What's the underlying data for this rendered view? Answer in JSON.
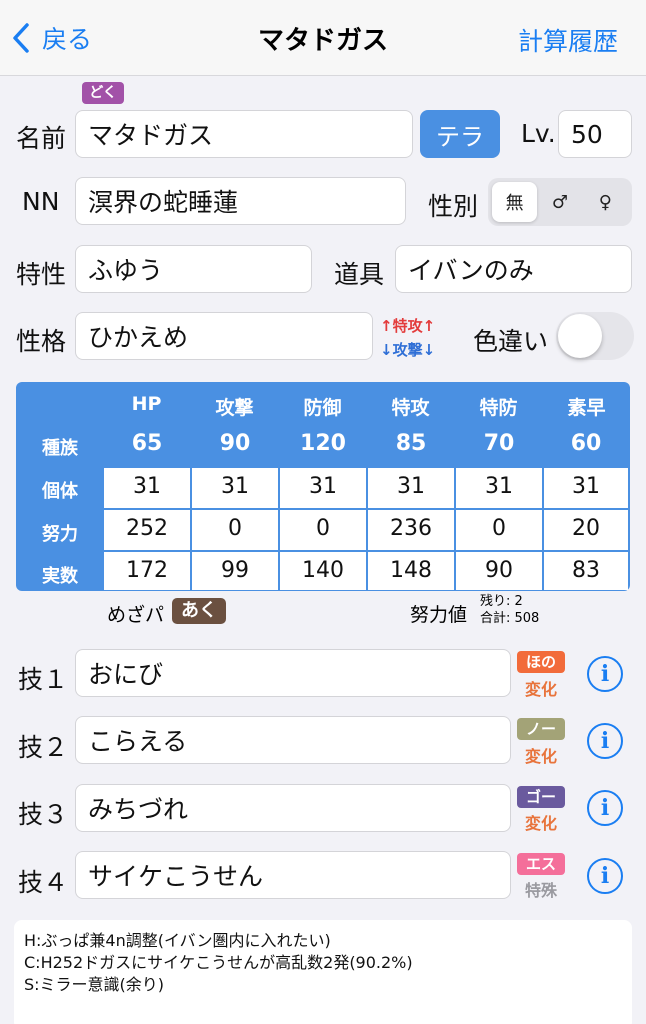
{
  "nav": {
    "back_label": "戻る",
    "title": "マタドガス",
    "history_label": "計算履歴"
  },
  "type_badge": {
    "label": "どく",
    "color": "#a252a8"
  },
  "form": {
    "name_label": "名前",
    "name_value": "マタドガス",
    "tera_label": "テラ",
    "level_label": "Lv.",
    "level_value": "50",
    "nn_label": "NN",
    "nn_value": "溟界の蛇睡蓮",
    "gender_label": "性別",
    "gender_options": [
      "無",
      "♂",
      "♀"
    ],
    "gender_selected": "無",
    "ability_label": "特性",
    "ability_value": "ふゆう",
    "item_label": "道具",
    "item_value": "イバンのみ",
    "nature_label": "性格",
    "nature_value": "ひかえめ",
    "nature_up": "↑特攻↑",
    "nature_down": "↓攻撃↓",
    "shiny_label": "色違い",
    "shiny_on": false
  },
  "stats": {
    "headers": [
      "HP",
      "攻撃",
      "防御",
      "特攻",
      "特防",
      "素早"
    ],
    "rows": [
      {
        "label": "種族",
        "values": [
          "65",
          "90",
          "120",
          "85",
          "70",
          "60"
        ]
      },
      {
        "label": "個体",
        "values": [
          "31",
          "31",
          "31",
          "31",
          "31",
          "31"
        ]
      },
      {
        "label": "努力",
        "values": [
          "252",
          "0",
          "0",
          "236",
          "0",
          "20"
        ]
      },
      {
        "label": "実数",
        "values": [
          "172",
          "99",
          "140",
          "148",
          "90",
          "83"
        ]
      }
    ]
  },
  "hidden_power": {
    "label": "めざパ",
    "type": "あく",
    "color": "#6b5040"
  },
  "ev_summary": {
    "label": "努力値",
    "remaining": "残り: 2",
    "total": "合計: 508"
  },
  "moves": [
    {
      "label": "技１",
      "name": "おにび",
      "type": "ほの",
      "type_color": "#f26b3a",
      "category": "変化",
      "category_color": "#e8743c"
    },
    {
      "label": "技２",
      "name": "こらえる",
      "type": "ノー",
      "type_color": "#a3a377",
      "category": "変化",
      "category_color": "#e8743c"
    },
    {
      "label": "技３",
      "name": "みちづれ",
      "type": "ゴー",
      "type_color": "#6a5a9e",
      "category": "変化",
      "category_color": "#e8743c"
    },
    {
      "label": "技４",
      "name": "サイケこうせん",
      "type": "エス",
      "type_color": "#f46f9a",
      "category": "特殊",
      "category_color": "#9a9aa0"
    }
  ],
  "memo": {
    "lines": [
      "H:ぶっぱ兼4n調整(イバン圏内に入れたい)",
      "C:H252ドガスにサイケこうせんが高乱数2発(90.2%)",
      "S:ミラー意識(余り)"
    ]
  },
  "colors": {
    "accent": "#1a7ef2",
    "stat_panel": "#4a90e2",
    "nature_up": "#e33b3b",
    "nature_down": "#2f6fd6"
  }
}
